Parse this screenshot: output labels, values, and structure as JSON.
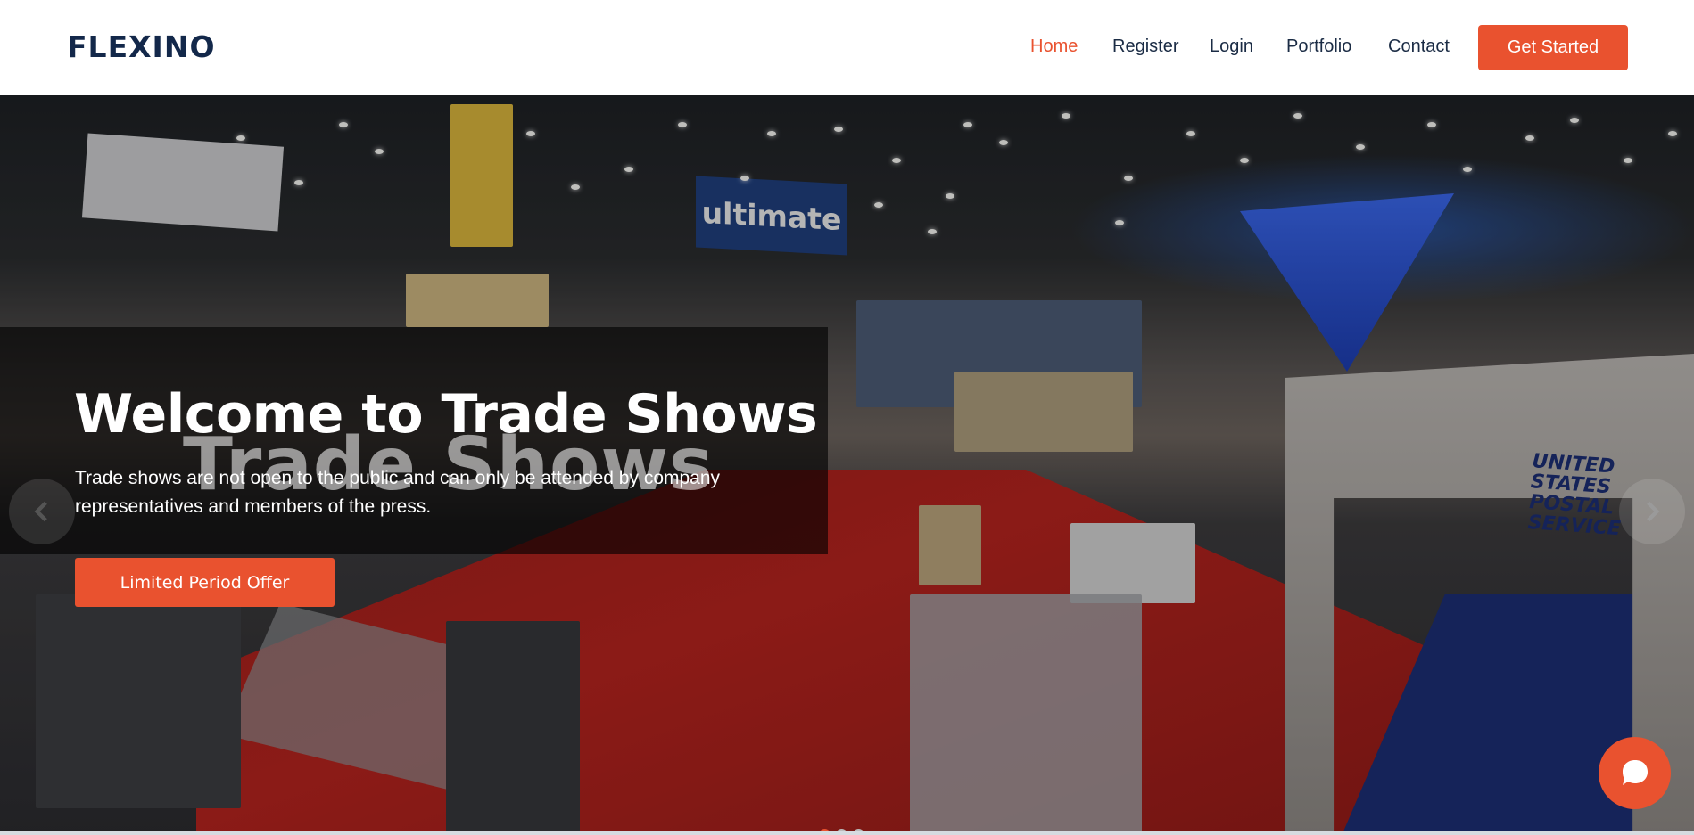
{
  "header": {
    "logo": "FLEXINO",
    "nav": [
      {
        "label": "Home",
        "active": true
      },
      {
        "label": "Register",
        "active": false
      },
      {
        "label": "Login",
        "active": false
      },
      {
        "label": "Portfolio",
        "active": false
      },
      {
        "label": "Contact",
        "active": false
      }
    ],
    "cta_label": "Get Started"
  },
  "hero": {
    "background_text": "Trade Shows",
    "title": "Welcome to Trade Shows",
    "subtitle": "Trade shows are not open to the public and can only be attended by company representatives and members of the press.",
    "button_label": "Limited Period Offer",
    "banner_text": "ultimate",
    "sign_text": "UNITED STATES POSTAL SERVICE",
    "prev_icon": "chevron-left-icon",
    "next_icon": "chevron-right-icon",
    "slide_count": 3,
    "active_slide": 1
  },
  "chat": {
    "icon": "chat-bubble-icon"
  },
  "colors": {
    "accent": "#e9522f",
    "nav_text": "#1b2c45",
    "logo": "#13284a"
  }
}
